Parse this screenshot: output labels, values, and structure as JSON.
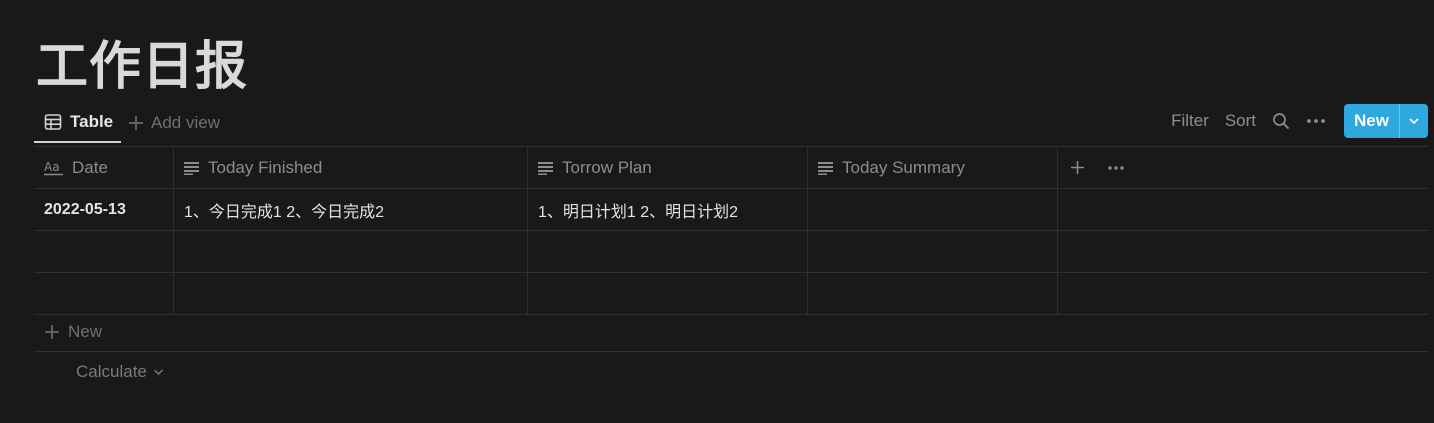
{
  "page": {
    "title": "工作日报"
  },
  "views": {
    "active_tab": {
      "label": "Table",
      "icon": "table-icon"
    },
    "add_view_label": "Add view"
  },
  "toolbar": {
    "filter_label": "Filter",
    "sort_label": "Sort",
    "search_icon": "search-icon",
    "more_icon": "more-icon",
    "new_label": "New",
    "accent": "#2ea8df"
  },
  "table": {
    "columns": [
      {
        "label": "Date",
        "icon": "title-property-icon"
      },
      {
        "label": "Today Finished",
        "icon": "text-property-icon"
      },
      {
        "label": "Torrow Plan",
        "icon": "text-property-icon"
      },
      {
        "label": "Today Summary",
        "icon": "text-property-icon"
      }
    ],
    "rows": [
      {
        "date": "2022-05-13",
        "today_finished": "1、今日完成1 2、今日完成2",
        "torrow_plan": "1、明日计划1 2、明日计划2",
        "today_summary": ""
      },
      {
        "date": "",
        "today_finished": "",
        "torrow_plan": "",
        "today_summary": ""
      },
      {
        "date": "",
        "today_finished": "",
        "torrow_plan": "",
        "today_summary": ""
      }
    ],
    "new_row_label": "New",
    "calculate_label": "Calculate"
  }
}
